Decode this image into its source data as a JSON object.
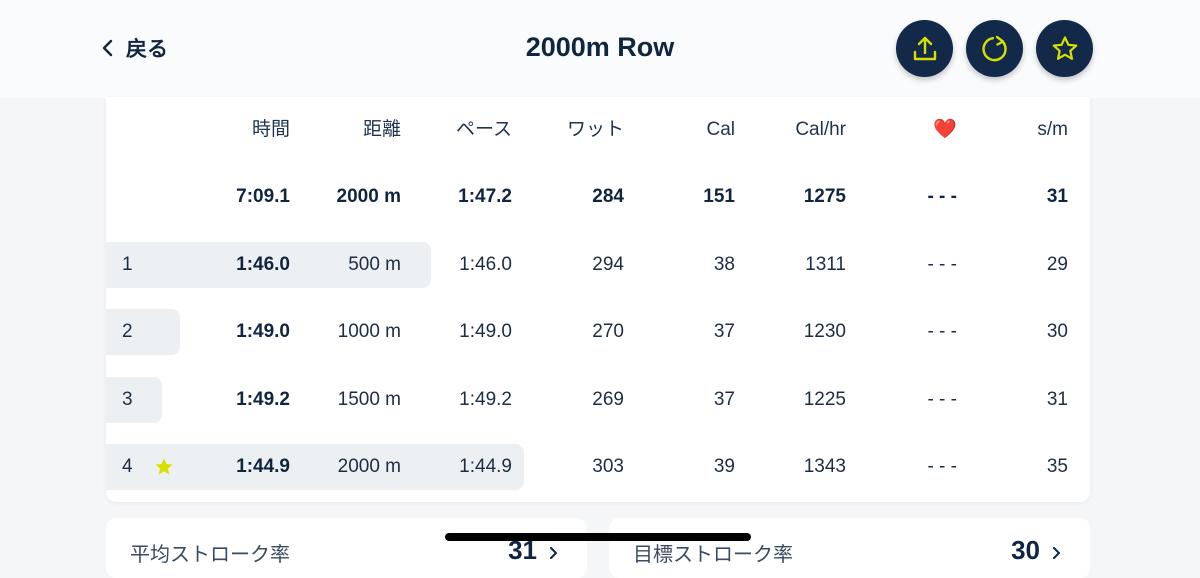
{
  "nav": {
    "back_label": "戻る",
    "title": "2000m Row"
  },
  "actions": [
    {
      "name": "share-button",
      "icon": "upload-icon"
    },
    {
      "name": "redo-button",
      "icon": "refresh-icon"
    },
    {
      "name": "favorite-button",
      "icon": "star-icon"
    }
  ],
  "table": {
    "headers": [
      "時間",
      "距離",
      "ペース",
      "ワット",
      "Cal",
      "Cal/hr",
      "❤️",
      "s/m"
    ],
    "total": [
      "7:09.1",
      "2000 m",
      "1:47.2",
      "284",
      "151",
      "1275",
      "- - -",
      "31"
    ],
    "splits": [
      {
        "index": "1",
        "starred": false,
        "bar_fraction": 0.3298,
        "cells": [
          "1:46.0",
          "500 m",
          "1:46.0",
          "294",
          "38",
          "1311",
          "- - -",
          "29"
        ]
      },
      {
        "index": "2",
        "starred": false,
        "bar_fraction": 0.0755,
        "cells": [
          "1:49.0",
          "1000 m",
          "1:49.0",
          "270",
          "37",
          "1230",
          "- - -",
          "30"
        ]
      },
      {
        "index": "3",
        "starred": false,
        "bar_fraction": 0.0567,
        "cells": [
          "1:49.2",
          "1500 m",
          "1:49.2",
          "269",
          "37",
          "1225",
          "- - -",
          "31"
        ]
      },
      {
        "index": "4",
        "starred": true,
        "bar_fraction": 0.4244,
        "cells": [
          "1:44.9",
          "2000 m",
          "1:44.9",
          "303",
          "39",
          "1343",
          "- - -",
          "35"
        ]
      }
    ]
  },
  "stats": [
    {
      "label": "平均ストローク率",
      "value": "31"
    },
    {
      "label": "目標ストローク率",
      "value": "30"
    }
  ],
  "colors": {
    "navy": "#13294a",
    "accent": "#d7e000",
    "bar": "#edf0f3",
    "heart": "#e0392b"
  }
}
